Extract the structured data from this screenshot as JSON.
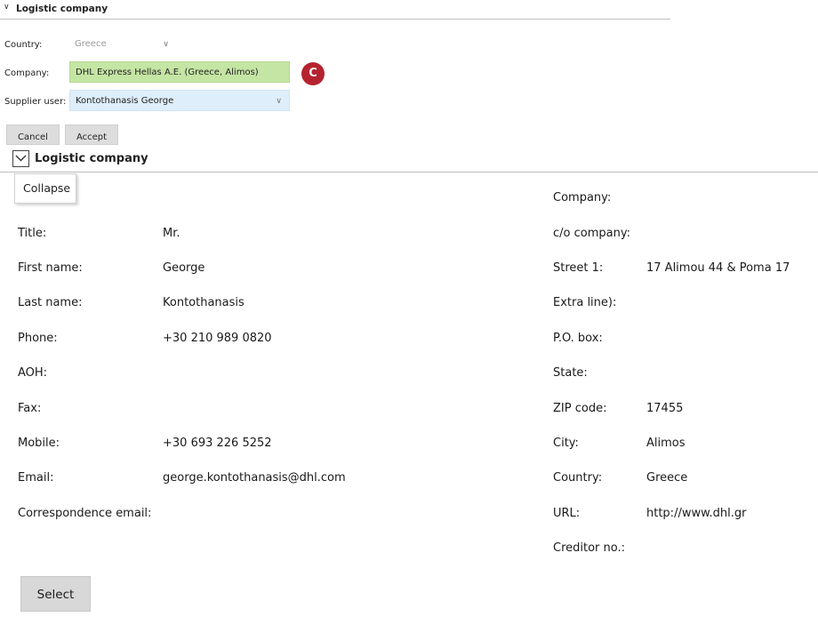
{
  "top_section": {
    "title": "Logistic company",
    "country_label": "Country:",
    "country_value": "Greece",
    "company_label": "Company:",
    "company_value": "DHL Express Hellas A.E. (Greece, Alimos)",
    "badge_letter": "C",
    "supplier_label": "Supplier user:",
    "supplier_value": "Kontothanasis George",
    "cancel_label": "Cancel",
    "accept_label": "Accept"
  },
  "main_section": {
    "title": "Logistic company",
    "tooltip": "Collapse"
  },
  "contact": [
    {
      "label": "Title:",
      "value": "Mr."
    },
    {
      "label": "First name:",
      "value": "George"
    },
    {
      "label": "Last name:",
      "value": "Kontothanasis"
    },
    {
      "label": "Phone:",
      "value": "+30 210 989 0820"
    },
    {
      "label": "AOH:",
      "value": ""
    },
    {
      "label": "Fax:",
      "value": ""
    },
    {
      "label": "Mobile:",
      "value": "+30 693 226 5252"
    },
    {
      "label": "Email:",
      "value": "george.kontothanasis@dhl.com"
    },
    {
      "label": "Correspondence email:",
      "value": ""
    }
  ],
  "company_info": [
    {
      "label": "Company:",
      "value": ""
    },
    {
      "label": "c/o company:",
      "value": ""
    },
    {
      "label": "Street 1:",
      "value": "17 Alimou 44 & Poma 17"
    },
    {
      "label": "Extra line):",
      "value": ""
    },
    {
      "label": "P.O. box:",
      "value": ""
    },
    {
      "label": "State:",
      "value": ""
    },
    {
      "label": "ZIP code:",
      "value": "17455"
    },
    {
      "label": "City:",
      "value": "Alimos"
    },
    {
      "label": "Country:",
      "value": "Greece"
    },
    {
      "label": "URL:",
      "value": "http://www.dhl.gr"
    },
    {
      "label": "Creditor no.:",
      "value": ""
    }
  ],
  "select_label": "Select",
  "colors": {
    "company_field_bg": "#c5e5a4",
    "supplier_field_bg": "#deeefb",
    "badge_bg": "#b4232f",
    "button_bg": "#dddddd"
  }
}
